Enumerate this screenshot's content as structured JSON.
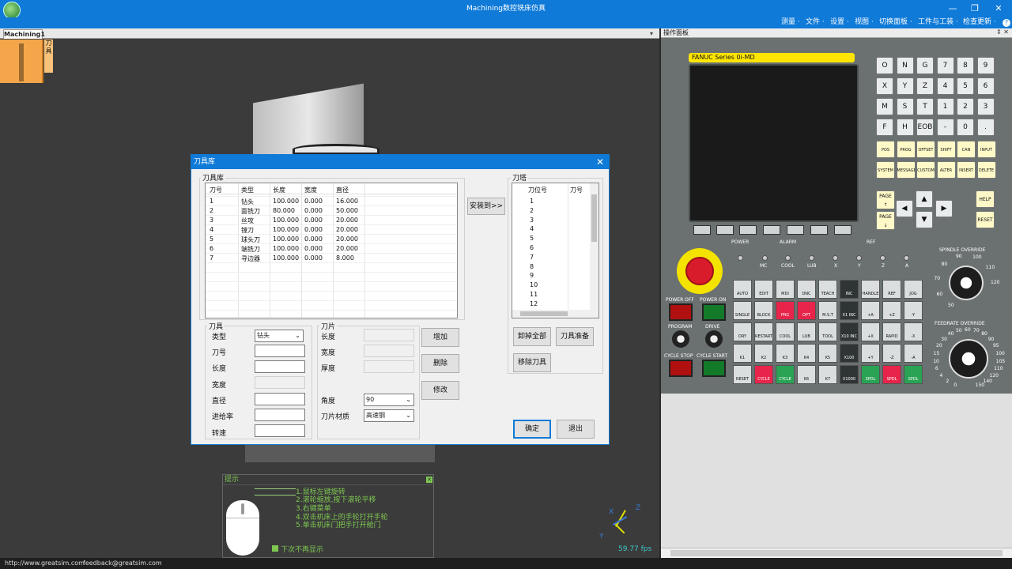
{
  "window": {
    "title": "Machining数控铣床仿真",
    "minimize": "—",
    "maximize": "❐",
    "close": "✕"
  },
  "menu": [
    "测量 ·",
    "文件 ·",
    "设置 ·",
    "视图 ·",
    "切换面板 ·",
    "工件与工装 ·",
    "检查更新 ·",
    "?"
  ],
  "doc_tab": "Machining1",
  "tool_label": "刀具",
  "dialog": {
    "title": "刀具库",
    "library_label": "刀具库",
    "library_columns": [
      "刀号",
      "类型",
      "长度",
      "宽度",
      "直径"
    ],
    "library_rows": [
      [
        "1",
        "钻头",
        "100.000",
        "0.000",
        "16.000"
      ],
      [
        "2",
        "面铣刀",
        "80.000",
        "0.000",
        "50.000"
      ],
      [
        "3",
        "丝攻",
        "100.000",
        "0.000",
        "20.000"
      ],
      [
        "4",
        "镗刀",
        "100.000",
        "0.000",
        "20.000"
      ],
      [
        "5",
        "球头刀",
        "100.000",
        "0.000",
        "20.000"
      ],
      [
        "6",
        "端铣刀",
        "100.000",
        "0.000",
        "20.000"
      ],
      [
        "7",
        "寻边器",
        "100.000",
        "0.000",
        "8.000"
      ]
    ],
    "install_btn": "安装到>>",
    "magazine_label": "刀塔",
    "magazine_columns": [
      "刀位号",
      "刀号"
    ],
    "magazine_rows": [
      "1",
      "2",
      "3",
      "4",
      "5",
      "6",
      "7",
      "8",
      "9",
      "10",
      "11",
      "12"
    ],
    "tool_group": "刀具",
    "tool_fields": {
      "type_label": "类型",
      "type_value": "钻头",
      "number_label": "刀号",
      "length_label": "长度",
      "width_label": "宽度",
      "diameter_label": "直径",
      "feed_label": "进给率",
      "speed_label": "转速"
    },
    "insert_group": "刀片",
    "insert_fields": {
      "length_label": "长度",
      "width_label": "宽度",
      "thickness_label": "厚度",
      "angle_label": "角度",
      "angle_value": "90",
      "material_label": "刀片材质",
      "material_value": "高速钢"
    },
    "add_btn": "增加",
    "delete_btn": "删除",
    "modify_btn": "修改",
    "unload_all_btn": "卸掉全部",
    "prepare_btn": "刀具准备",
    "remove_btn": "移除刀具",
    "ok_btn": "确定",
    "exit_btn": "退出"
  },
  "hint": {
    "title": "提示",
    "lines": [
      "1.鼠标左键旋转",
      "2.滚轮缩放,按下滚轮平移",
      "3.右键菜单",
      "4.双击机床上的手轮打开手轮",
      "5.单击机床门把手打开舱门"
    ],
    "checkbox_label": "下次不再显示"
  },
  "fps": "59.77 fps",
  "axes": {
    "x": "X",
    "y": "Y",
    "z": "Z"
  },
  "status": {
    "url": "http://www.greatsim.com",
    "feedback": "feedback@greatsim.com"
  },
  "panel": {
    "title": "操作面板",
    "pin": "⇕ ✕",
    "fanuc": "FANUC Series 0i-MD",
    "addr_keys": [
      "O",
      "N",
      "G",
      "7",
      "8",
      "9",
      "X",
      "Y",
      "Z",
      "4",
      "5",
      "6",
      "M",
      "S",
      "T",
      "1",
      "2",
      "3",
      "F",
      "H",
      "EOB",
      "-",
      "0",
      "."
    ],
    "func_keys": [
      "POS",
      "PROG",
      "OFFSET SETTING",
      "SHIFT",
      "CAN",
      "INPUT",
      "SYSTEM",
      "MESSAGE",
      "CUSTOM GRAPH",
      "ALTER",
      "INSERT",
      "DELETE"
    ],
    "page_up": "PAGE ↑",
    "page_down": "PAGE ↓",
    "help": "HELP",
    "reset": "RESET",
    "labels": {
      "power": "POWER",
      "alarm": "ALARM",
      "ref": "REF",
      "mc": "MC",
      "cool": "COOL",
      "lub": "LUB",
      "x": "X",
      "y": "Y",
      "z": "Z",
      "a": "A",
      "power_off": "POWER OFF",
      "power_on": "POWER ON",
      "program": "PROGRAM",
      "drive": "DRIVE",
      "cycle_stop": "CYCLE STOP",
      "cycle_start": "CYCLE START",
      "spindle_override": "SPINDLE OVERRIDE",
      "feedrate_override": "FEEDRATE OVERRIDE"
    },
    "op_keys": [
      "AUTO",
      "EDIT",
      "MDI",
      "DNC",
      "TEACH",
      "INC",
      "HANDLE",
      "REF",
      "JOG",
      "SINGLE BLOCK",
      "BLOCK SKIP",
      "PRG STOP",
      "OPT STOP",
      "M.S.T LOCK",
      "X1 INC",
      "+A",
      "+Z",
      "-Y",
      "DRY RUN",
      "RESTART",
      "COOL",
      "LUB",
      "TOOL",
      "X10 INC",
      "+X",
      "RAPID",
      "-X",
      "K1",
      "K2",
      "K3",
      "K4",
      "K5",
      "X100 INC",
      "+Y",
      "-Z",
      "-A",
      "RESET",
      "CYCLE STOP",
      "CYCLE START",
      "K6",
      "K7",
      "X1000 INC",
      "SPDL CW",
      "SPDL STOP",
      "SPDL CCW"
    ],
    "spindle_ticks": [
      "50",
      "60",
      "70",
      "80",
      "90",
      "100",
      "110",
      "120"
    ],
    "feed_ticks": [
      "0",
      "2",
      "4",
      "6",
      "10",
      "15",
      "20",
      "30",
      "40",
      "50",
      "60",
      "70",
      "80",
      "90",
      "95",
      "100",
      "105",
      "110",
      "120",
      "140",
      "150"
    ]
  }
}
